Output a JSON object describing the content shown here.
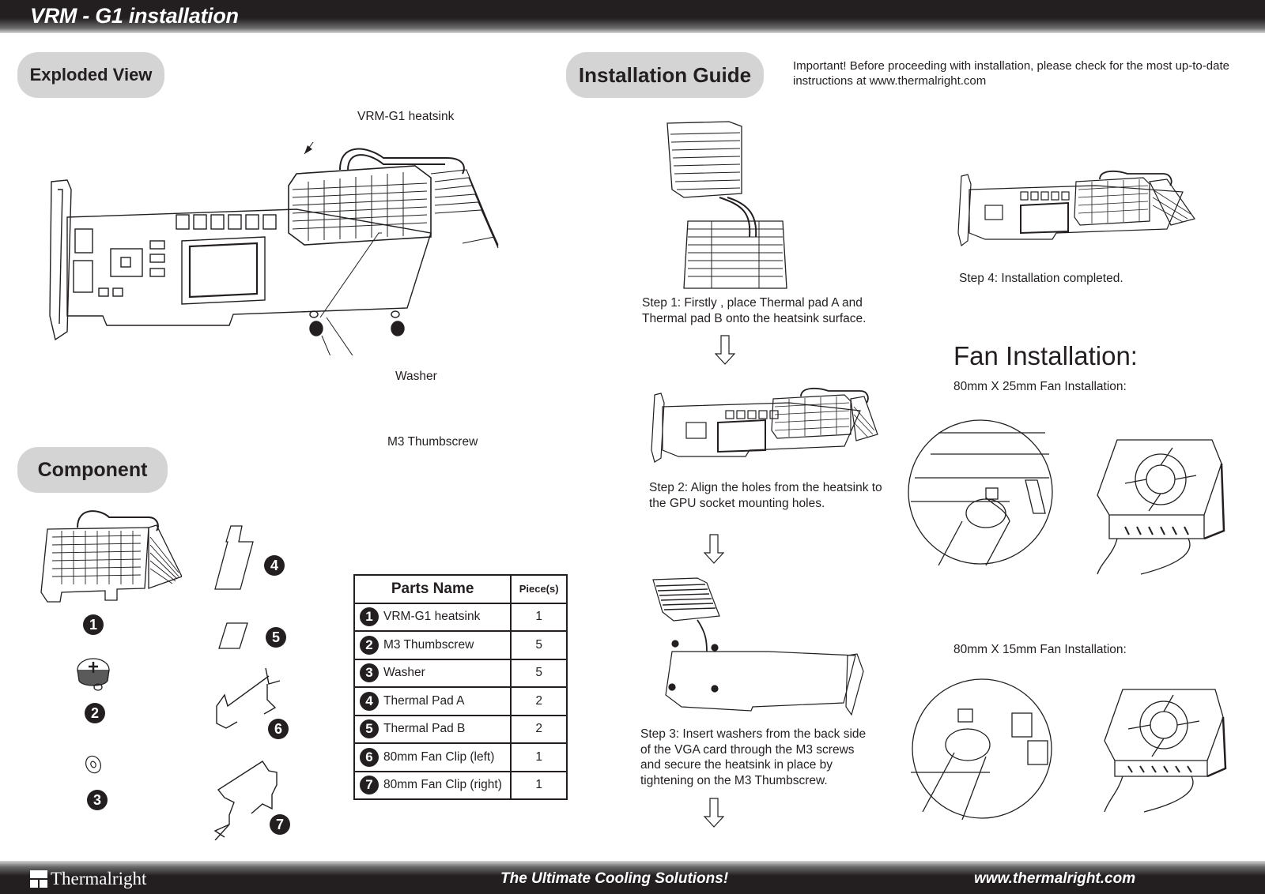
{
  "header": {
    "title": "VRM - G1 installation"
  },
  "sections": {
    "exploded_view": "Exploded View",
    "component": "Component",
    "installation_guide": "Installation Guide"
  },
  "notice": "Important! Before proceeding with installation, please check for the most up-to-date instructions at www.thermalright.com",
  "exploded_callouts": {
    "heatsink": "VRM-G1 heatsink",
    "washer": "Washer",
    "thumbscrew": "M3 Thumbscrew"
  },
  "components": [
    {
      "number": "1",
      "illustration": "heatsink-illustration"
    },
    {
      "number": "2",
      "illustration": "thumbscrew-illustration"
    },
    {
      "number": "3",
      "illustration": "washer-illustration"
    },
    {
      "number": "4",
      "illustration": "thermal-pad-a-illustration"
    },
    {
      "number": "5",
      "illustration": "thermal-pad-b-illustration"
    },
    {
      "number": "6",
      "illustration": "fan-clip-left-illustration"
    },
    {
      "number": "7",
      "illustration": "fan-clip-right-illustration"
    }
  ],
  "parts_table": {
    "headers": {
      "name": "Parts Name",
      "qty": "Piece(s)"
    },
    "rows": [
      {
        "number": "1",
        "name": "VRM-G1 heatsink",
        "qty": "1"
      },
      {
        "number": "2",
        "name": "M3 Thumbscrew",
        "qty": "5"
      },
      {
        "number": "3",
        "name": "Washer",
        "qty": "5"
      },
      {
        "number": "4",
        "name": "Thermal Pad A",
        "qty": "2"
      },
      {
        "number": "5",
        "name": "Thermal Pad B",
        "qty": "2"
      },
      {
        "number": "6",
        "name": "80mm Fan Clip (left)",
        "qty": "1"
      },
      {
        "number": "7",
        "name": "80mm Fan Clip (right)",
        "qty": "1"
      }
    ]
  },
  "steps": {
    "step1": "Step 1: Firstly , place Thermal pad A and Thermal pad B onto the heatsink surface.",
    "step2": "Step 2: Align the holes from the heatsink to the GPU socket mounting holes.",
    "step3": "Step 3: Insert washers from the back side of the VGA card through the M3 screws and secure the heatsink in place by tightening on the M3 Thumbscrew.",
    "step4": "Step 4: Installation completed."
  },
  "fan_installation": {
    "heading": "Fan Installation:",
    "fan_25mm": "80mm X 25mm Fan Installation:",
    "fan_15mm": "80mm X 15mm Fan Installation:"
  },
  "footer": {
    "brand": "Thermalright",
    "tagline": "The Ultimate Cooling Solutions!",
    "url": "www.thermalright.com"
  },
  "colors": {
    "ink": "#231f20",
    "pill_background": "#d4d4d4",
    "bar_dark": "#231f20"
  }
}
